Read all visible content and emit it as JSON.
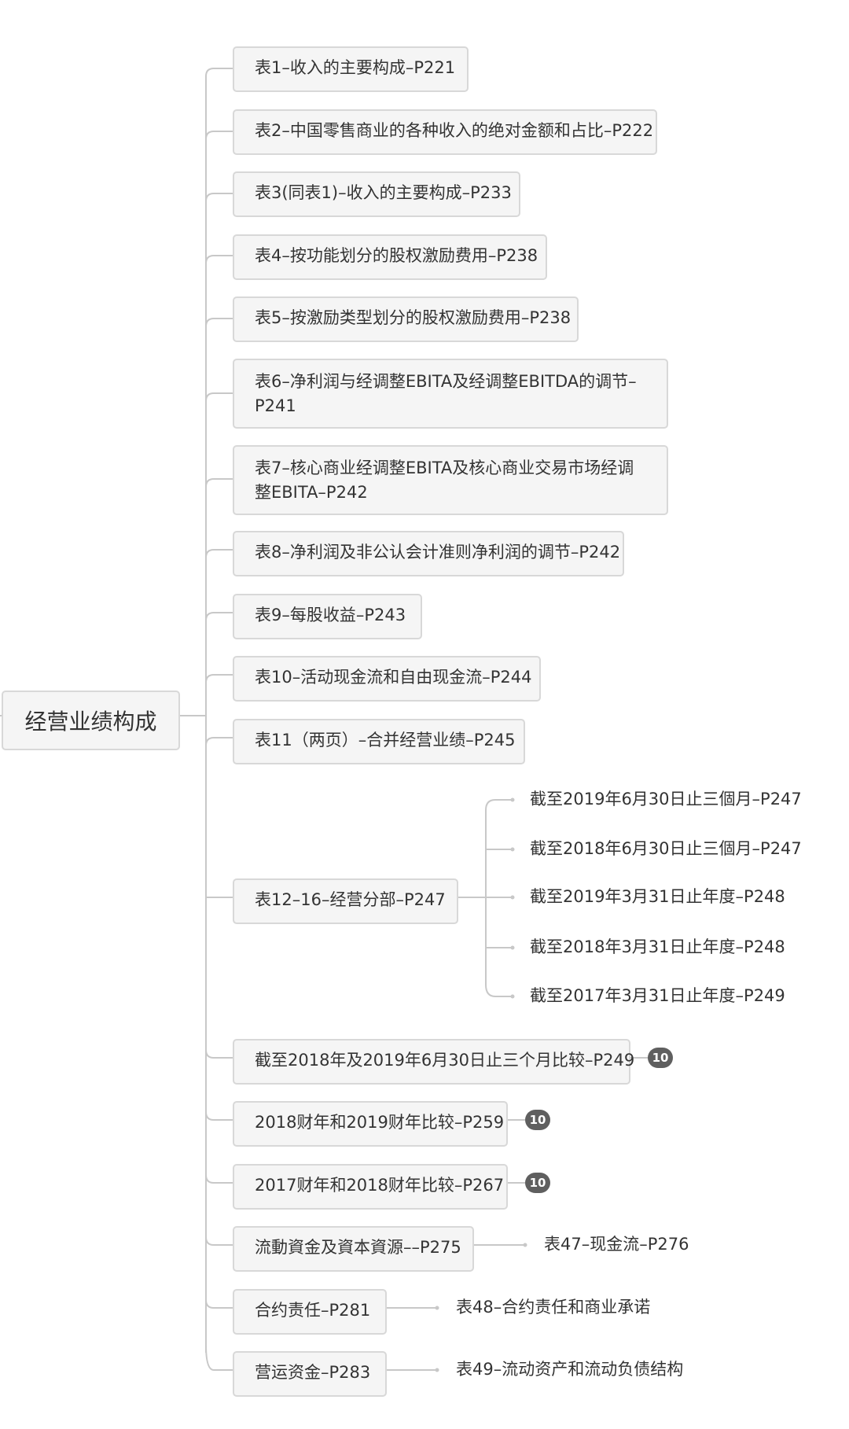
{
  "root": {
    "label": "经营业绩构成"
  },
  "branches": [
    {
      "label": "表1–收入的主要构成–P221"
    },
    {
      "label": "表2–中国零售商业的各种收入的绝对金额和占比–P222"
    },
    {
      "label": "表3(同表1)–收入的主要构成–P233"
    },
    {
      "label": "表4–按功能划分的股权激励费用–P238"
    },
    {
      "label": "表5–按激励类型划分的股权激励费用–P238"
    },
    {
      "label": "表6–净利润与经调整EBITA及经调整EBITDA的调节–P241"
    },
    {
      "label": "表7–核心商业经调整EBITA及核心商业交易市场经调整EBITA–P242"
    },
    {
      "label": "表8–净利润及非公认会计准则净利润的调节–P242"
    },
    {
      "label": "表9–每股收益–P243"
    },
    {
      "label": "表10–活动现金流和自由现金流–P244"
    },
    {
      "label": "表11（两页）–合并经营业绩–P245"
    },
    {
      "label": "表12–16–经营分部–P247",
      "children": [
        "截至2019年6月30日止三個月–P247",
        "截至2018年6月30日止三個月–P247",
        "截至2019年3月31日止年度–P248",
        "截至2018年3月31日止年度–P248",
        "截至2017年3月31日止年度–P249"
      ]
    },
    {
      "label": "截至2018年及2019年6月30日止三个月比较–P249",
      "badge": "10"
    },
    {
      "label": "2018财年和2019财年比较–P259",
      "badge": "10"
    },
    {
      "label": "2017财年和2018财年比较–P267",
      "badge": "10"
    },
    {
      "label": "流動資金及資本資源––P275",
      "children": [
        "表47–现金流–P276"
      ]
    },
    {
      "label": "合约责任–P281",
      "children": [
        "表48–合约责任和商业承诺"
      ]
    },
    {
      "label": "营运资金–P283",
      "children": [
        "表49–流动资产和流动负债结构"
      ]
    }
  ]
}
